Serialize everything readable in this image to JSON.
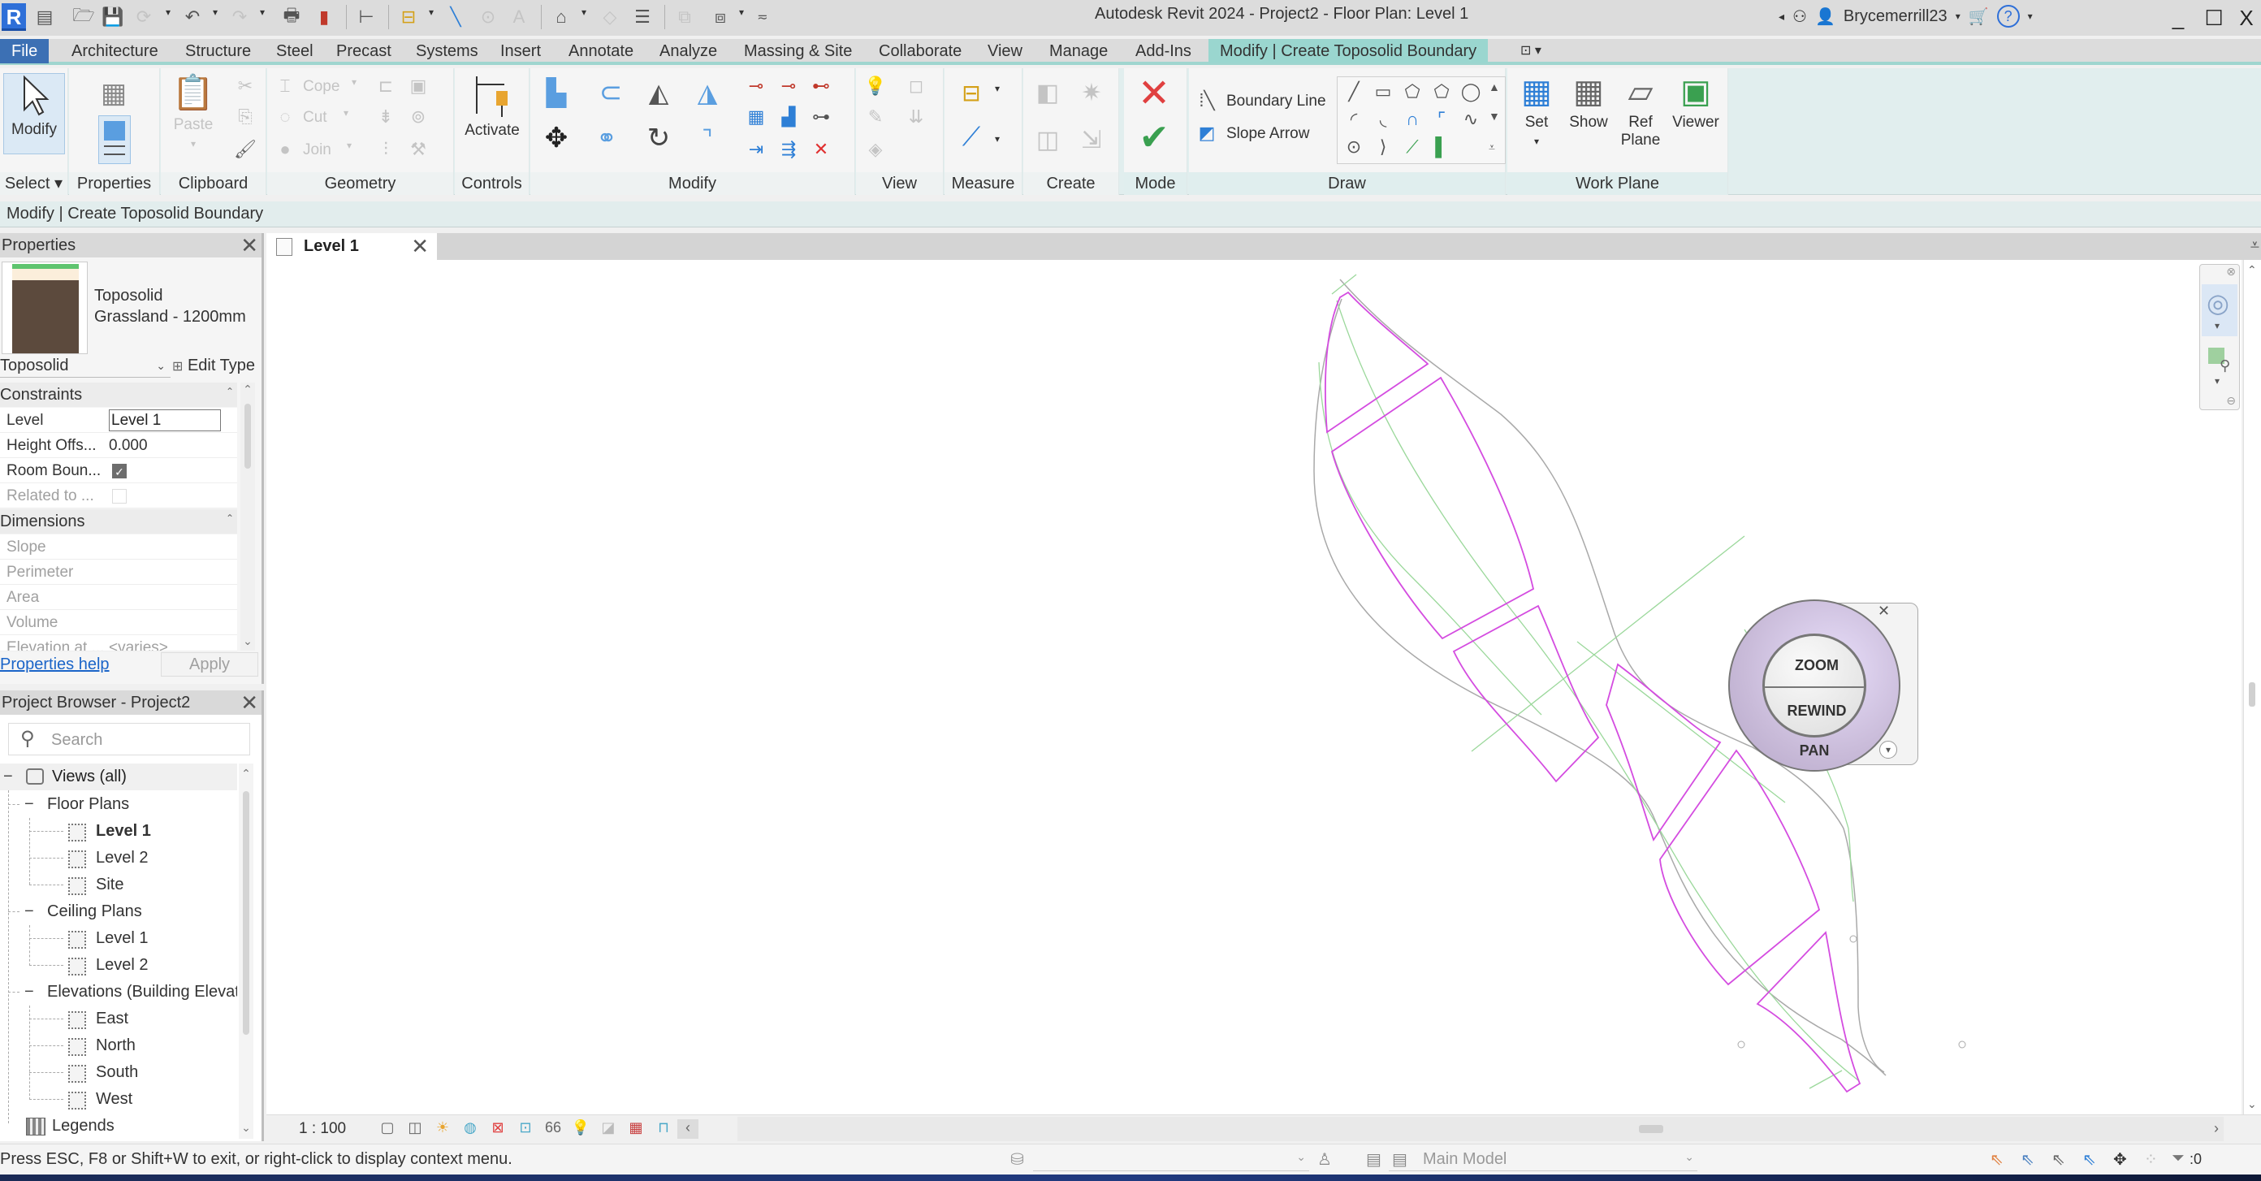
{
  "window": {
    "title": "Autodesk Revit 2024 - Project2 - Floor Plan: Level 1",
    "app_logo": "R",
    "user": "Brycemerrill23",
    "quick_access_icons": [
      "open-icon",
      "save-icon",
      "sync-icon",
      "undo-icon",
      "redo-icon",
      "print-icon",
      "export-icon",
      "aligned-dimension-icon",
      "measure-icon",
      "tag-icon",
      "text-icon",
      "3d-view-icon",
      "section-icon",
      "thin-lines-icon",
      "close-hidden-icon",
      "switch-windows-icon",
      "customize-icon"
    ],
    "controls": {
      "minimize": "_",
      "maximize": "☐",
      "close": "X"
    }
  },
  "ribbon": {
    "tabs": [
      {
        "label": "File"
      },
      {
        "label": "Architecture"
      },
      {
        "label": "Structure"
      },
      {
        "label": "Steel"
      },
      {
        "label": "Precast"
      },
      {
        "label": "Systems"
      },
      {
        "label": "Insert"
      },
      {
        "label": "Annotate"
      },
      {
        "label": "Analyze"
      },
      {
        "label": "Massing & Site"
      },
      {
        "label": "Collaborate"
      },
      {
        "label": "View"
      },
      {
        "label": "Manage"
      },
      {
        "label": "Add-Ins"
      },
      {
        "label": "Modify | Create Toposolid Boundary",
        "active": true
      }
    ],
    "panels": {
      "select": {
        "label": "Select",
        "modify_button": "Modify"
      },
      "properties": {
        "label": "Properties"
      },
      "clipboard": {
        "label": "Clipboard",
        "paste": "Paste"
      },
      "geometry": {
        "label": "Geometry",
        "cope": "Cope",
        "cut": "Cut",
        "join": "Join"
      },
      "controls": {
        "label": "Controls",
        "activate": "Activate"
      },
      "modify": {
        "label": "Modify"
      },
      "view": {
        "label": "View"
      },
      "measure": {
        "label": "Measure"
      },
      "create": {
        "label": "Create"
      },
      "mode": {
        "label": "Mode",
        "cancel": "Cancel Edit Mode",
        "finish": "Finish Edit Mode"
      },
      "draw": {
        "label": "Draw",
        "boundary_line": "Boundary Line",
        "slope_arrow": "Slope Arrow"
      },
      "work_plane": {
        "label": "Work Plane",
        "set": "Set",
        "show": "Show",
        "ref_plane_1": "Ref",
        "ref_plane_2": "Plane",
        "viewer": "Viewer"
      }
    }
  },
  "options_bar": {
    "text": "Modify | Create Toposolid Boundary"
  },
  "properties": {
    "title": "Properties",
    "type_family": "Toposolid",
    "type_name": "Grassland - 1200mm",
    "selector": "Toposolid",
    "edit_type": "Edit Type",
    "groups": [
      {
        "name": "Constraints",
        "rows": [
          {
            "name": "Level",
            "value": "Level 1",
            "kind": "input"
          },
          {
            "name": "Height Offs...",
            "value": "0.000",
            "kind": "text"
          },
          {
            "name": "Room Boun...",
            "value": true,
            "kind": "checkbox"
          },
          {
            "name": "Related to ...",
            "value": false,
            "kind": "checkbox",
            "disabled": true
          }
        ]
      },
      {
        "name": "Dimensions",
        "rows": [
          {
            "name": "Slope",
            "value": ""
          },
          {
            "name": "Perimeter",
            "value": ""
          },
          {
            "name": "Area",
            "value": ""
          },
          {
            "name": "Volume",
            "value": ""
          },
          {
            "name": "Elevation at ...",
            "value": "<varies>"
          }
        ]
      }
    ],
    "help_link": "Properties help",
    "apply": "Apply"
  },
  "project_browser": {
    "title": "Project Browser - Project2",
    "search_placeholder": "Search",
    "root": "Views (all)",
    "groups": [
      {
        "label": "Floor Plans",
        "items": [
          {
            "label": "Level 1",
            "active": true
          },
          {
            "label": "Level 2"
          },
          {
            "label": "Site"
          }
        ]
      },
      {
        "label": "Ceiling Plans",
        "items": [
          {
            "label": "Level 1"
          },
          {
            "label": "Level 2"
          }
        ]
      },
      {
        "label": "Elevations (Building Elevati",
        "items": [
          {
            "label": "East"
          },
          {
            "label": "North"
          },
          {
            "label": "South"
          },
          {
            "label": "West"
          }
        ]
      }
    ],
    "legends": "Legends"
  },
  "view": {
    "tab_label": "Level 1",
    "scale": "1 : 100",
    "steering_wheel": {
      "zoom": "ZOOM",
      "rewind": "REWIND",
      "pan": "PAN"
    },
    "colors": {
      "sketch": "#d44ce0",
      "topo": "#a9a9a9",
      "ref": "#9bd89b"
    }
  },
  "status_bar": {
    "message": "Press ESC, F8 or Shift+W to exit, or right-click to display context menu.",
    "model": "Main Model",
    "filter_count": ":0",
    "design_option_count": ":0"
  }
}
